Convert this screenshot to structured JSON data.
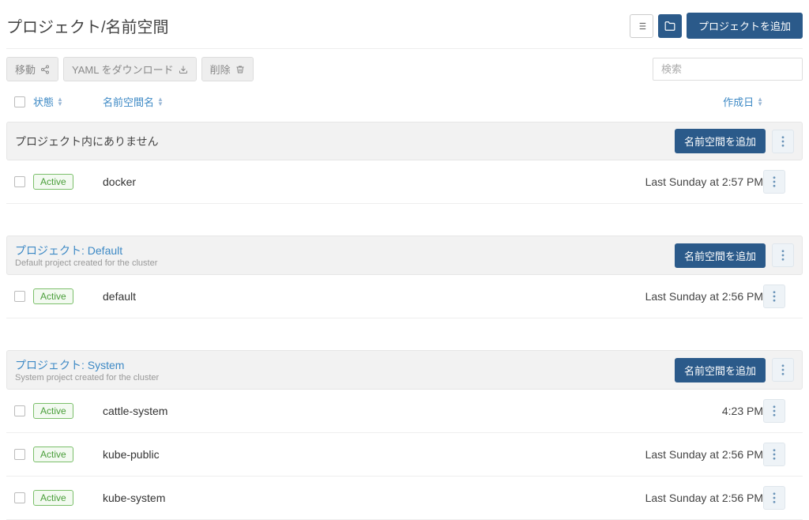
{
  "header": {
    "title": "プロジェクト/名前空間",
    "add_project_label": "プロジェクトを追加"
  },
  "toolbar": {
    "move_label": "移動",
    "download_yaml_label": "YAML をダウンロード",
    "delete_label": "削除",
    "search_placeholder": "検索"
  },
  "columns": {
    "state": "状態",
    "name": "名前空間名",
    "created": "作成日"
  },
  "add_namespace_label": "名前空間を追加",
  "status_active_label": "Active",
  "groups": [
    {
      "title": "プロジェクト内にありません",
      "is_link": false,
      "subtitle": "",
      "rows": [
        {
          "name": "docker",
          "created": "Last Sunday at 2:57 PM"
        }
      ]
    },
    {
      "title": "プロジェクト: Default",
      "is_link": true,
      "subtitle": "Default project created for the cluster",
      "rows": [
        {
          "name": "default",
          "created": "Last Sunday at 2:56 PM"
        }
      ]
    },
    {
      "title": "プロジェクト: System",
      "is_link": true,
      "subtitle": "System project created for the cluster",
      "rows": [
        {
          "name": "cattle-system",
          "created": "4:23 PM"
        },
        {
          "name": "kube-public",
          "created": "Last Sunday at 2:56 PM"
        },
        {
          "name": "kube-system",
          "created": "Last Sunday at 2:56 PM"
        }
      ]
    }
  ]
}
